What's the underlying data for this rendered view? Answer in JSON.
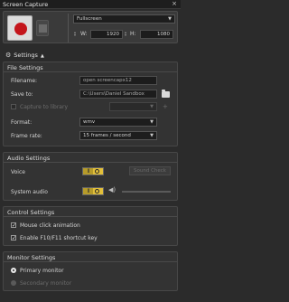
{
  "window": {
    "title": "Screen Capture",
    "close_glyph": "×"
  },
  "capture": {
    "region": "Fullscreen",
    "width_label": "W:",
    "width_value": "1920",
    "height_label": "H:",
    "height_value": "1080"
  },
  "settings_toggle": {
    "label": "Settings"
  },
  "file_settings": {
    "title": "File Settings",
    "filename_label": "Filename:",
    "filename_value": "open screencapx12",
    "save_to_label": "Save to:",
    "save_to_value": "C:\\Users\\Daniel Sandbox",
    "capture_library_label": "Capture to library",
    "format_label": "Format:",
    "format_value": "wmv",
    "frame_rate_label": "Frame rate:",
    "frame_rate_value": "15 frames / second"
  },
  "audio_settings": {
    "title": "Audio Settings",
    "voice_label": "Voice",
    "voice_check_label": "Sound Check",
    "system_audio_label": "System audio"
  },
  "control_settings": {
    "title": "Control Settings",
    "mouse_click_label": "Mouse click animation",
    "shortcut_label": "Enable F10/F11 shortcut key"
  },
  "monitor_settings": {
    "title": "Monitor Settings",
    "primary_label": "Primary monitor",
    "secondary_label": "Secondary monitor"
  },
  "colors": {
    "background": "#2b2b2b",
    "record_red": "#c4151b",
    "toggle_gold": "#e2bf3a"
  }
}
